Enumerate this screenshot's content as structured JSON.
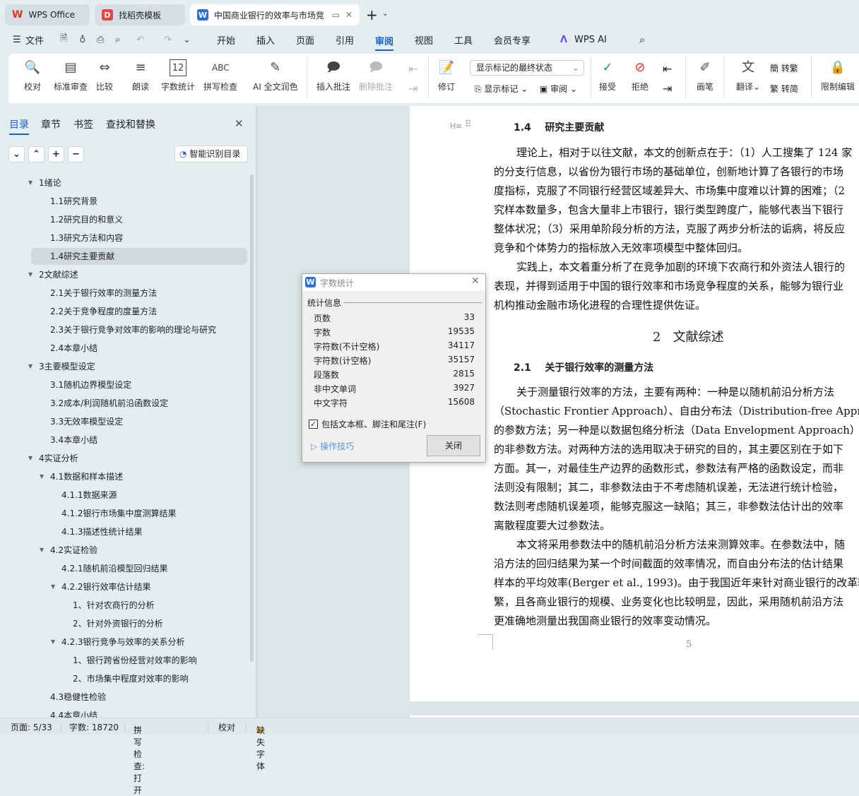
{
  "tabs": [
    {
      "label": "WPS Office"
    },
    {
      "label": "找稻壳模板"
    },
    {
      "label": "中国商业银行的效率与市场竞"
    }
  ],
  "menu": {
    "file": "文件",
    "items": [
      "开始",
      "插入",
      "页面",
      "引用",
      "审阅",
      "视图",
      "工具",
      "会员专享"
    ],
    "active": "审阅",
    "ai": "WPS AI"
  },
  "ribbon": {
    "proofread": "校对",
    "standard_review": "标准审查",
    "compare": "比较",
    "read_aloud": "朗读",
    "word_count": "字数统计",
    "spell_check": "拼写检查",
    "ai_polish": "AI 全文润色",
    "insert_comment": "插入批注",
    "delete_comment": "删除批注",
    "markup_state": "显示标记的最终状态",
    "track": "修订",
    "show_markup": "显示标记",
    "review": "审阅",
    "accept": "接受",
    "reject": "拒绝",
    "pen": "画笔",
    "translate": "翻译",
    "to_traditional": "转繁",
    "to_simplified": "转简",
    "restrict": "限制编辑"
  },
  "panel": {
    "tabs": [
      "目录",
      "章节",
      "书签",
      "查找和替换"
    ],
    "smart_toc": "智能识别目录",
    "toc": [
      {
        "label": "1绪论",
        "level": 0,
        "expanded": true
      },
      {
        "label": "1.1研究背景",
        "level": 1
      },
      {
        "label": "1.2研究目的和意义",
        "level": 1
      },
      {
        "label": "1.3研究方法和内容",
        "level": 1
      },
      {
        "label": "1.4研究主要贡献",
        "level": 1,
        "selected": true
      },
      {
        "label": "2文献综述",
        "level": 0,
        "expanded": true
      },
      {
        "label": "2.1关于银行效率的测量方法",
        "level": 1
      },
      {
        "label": "2.2关于竞争程度的度量方法",
        "level": 1
      },
      {
        "label": "2.3关于银行竞争对效率的影响的理论与研究",
        "level": 1
      },
      {
        "label": "2.4本章小结",
        "level": 1
      },
      {
        "label": "3主要模型设定",
        "level": 0,
        "expanded": true
      },
      {
        "label": "3.1随机边界模型设定",
        "level": 1
      },
      {
        "label": "3.2成本/利润随机前沿函数设定",
        "level": 1
      },
      {
        "label": "3.3无效率模型设定",
        "level": 1
      },
      {
        "label": "3.4本章小结",
        "level": 1
      },
      {
        "label": "4实证分析",
        "level": 0,
        "expanded": true
      },
      {
        "label": "4.1数据和样本描述",
        "level": 1,
        "expanded": true
      },
      {
        "label": "4.1.1数据来源",
        "level": 2
      },
      {
        "label": "4.1.2银行市场集中度测算结果",
        "level": 2
      },
      {
        "label": "4.1.3描述性统计结果",
        "level": 2
      },
      {
        "label": "4.2实证检验",
        "level": 1,
        "expanded": true
      },
      {
        "label": "4.2.1随机前沿模型回归结果",
        "level": 2
      },
      {
        "label": "4.2.2银行效率估计结果",
        "level": 2,
        "expanded": true
      },
      {
        "label": "1、针对农商行的分析",
        "level": 3
      },
      {
        "label": "2、针对外资银行的分析",
        "level": 3
      },
      {
        "label": "4.2.3银行竞争与效率的关系分析",
        "level": 2,
        "expanded": true
      },
      {
        "label": "1、银行跨省份经营对效率的影响",
        "level": 3
      },
      {
        "label": "2、市场集中程度对效率的影响",
        "level": 3
      },
      {
        "label": "4.3稳健性检验",
        "level": 1
      },
      {
        "label": "4.4本章小结",
        "level": 1
      }
    ]
  },
  "document": {
    "heading_marker": "H≡",
    "h14": {
      "num": "1.4",
      "text": "研究主要贡献"
    },
    "p1": [
      "理论上，相对于以往文献，本文的创新点在于：（1）人工搜集了 124 家",
      "的分支行信息，以省份为银行市场的基础单位，创新地计算了各银行的市场",
      "度指标，克服了不同银行经营区域差异大、市场集中度难以计算的困难；（2",
      "究样本数量多，包含大量非上市银行，银行类型跨度广，能够代表当下银行",
      "整体状况；（3）采用单阶段分析的方法，克服了两步分析法的诟病，将反应",
      "竞争和个体势力的指标放入无效率项模型中整体回归。"
    ],
    "p2": [
      "实践上，本文着重分析了在竞争加剧的环境下农商行和外资法人银行的",
      "表现，并得到适用于中国的银行效率和市场竞争程度的关系，能够为银行业",
      "机构推动金融市场化进程的合理性提供佐证。"
    ],
    "h2": {
      "num": "2",
      "text": "文献综述"
    },
    "h21": {
      "num": "2.1",
      "text": "关于银行效率的测量方法"
    },
    "p3": [
      "关于测量银行效率的方法，主要有两种：一种是以随机前沿分析方法",
      "（Stochastic Frontier Approach）、自由分布法（Distribution-free Approach）为",
      "的参数方法；另一种是以数据包络分析法（Data Envelopment Approach）为",
      "的非参数方法。对两种方法的选用取决于研究的目的，其主要区别在于如下",
      "方面。其一，对最佳生产边界的函数形式，参数法有严格的函数设定，而非",
      "法则没有限制；其二，非参数法由于不考虑随机误差，无法进行统计检验，",
      "数法则考虑随机误差项，能够克服这一缺陷；其三，非参数法估计出的效率",
      "离散程度要大过参数法。"
    ],
    "p4": [
      "本文将采用参数法中的随机前沿分析方法来测算效率。在参数法中，随",
      "沿方法的回归结果为某一个时间截面的效率情况，而自由分布法的估计结果",
      "样本的平均效率(Berger et al., 1993)。由于我国近年来针对商业银行的改革较",
      "繁，且各商业银行的规模、业务变化也比较明显，因此，采用随机前沿方法",
      "更准确地测量出我国商业银行的效率变动情况。"
    ],
    "page_number": "5"
  },
  "dialog": {
    "title": "字数统计",
    "section": "统计信息",
    "rows": [
      {
        "label": "页数",
        "value": "33"
      },
      {
        "label": "字数",
        "value": "19535"
      },
      {
        "label": "字符数(不计空格)",
        "value": "34117"
      },
      {
        "label": "字符数(计空格)",
        "value": "35157"
      },
      {
        "label": "段落数",
        "value": "2815"
      },
      {
        "label": "非中文单词",
        "value": "3927"
      },
      {
        "label": "中文字符",
        "value": "15608"
      }
    ],
    "checkbox": "包括文本框、脚注和尾注(F)",
    "checked": true,
    "tips": "操作技巧",
    "close": "关闭"
  },
  "status": {
    "page": "页面: 5/33",
    "words": "字数: 18720",
    "spell": "拼写检查: 打开",
    "proof": "校对",
    "missing_font": "缺失字体"
  },
  "colors": {
    "accent": "#1a5fd0",
    "wps_red": "#e8341c"
  }
}
